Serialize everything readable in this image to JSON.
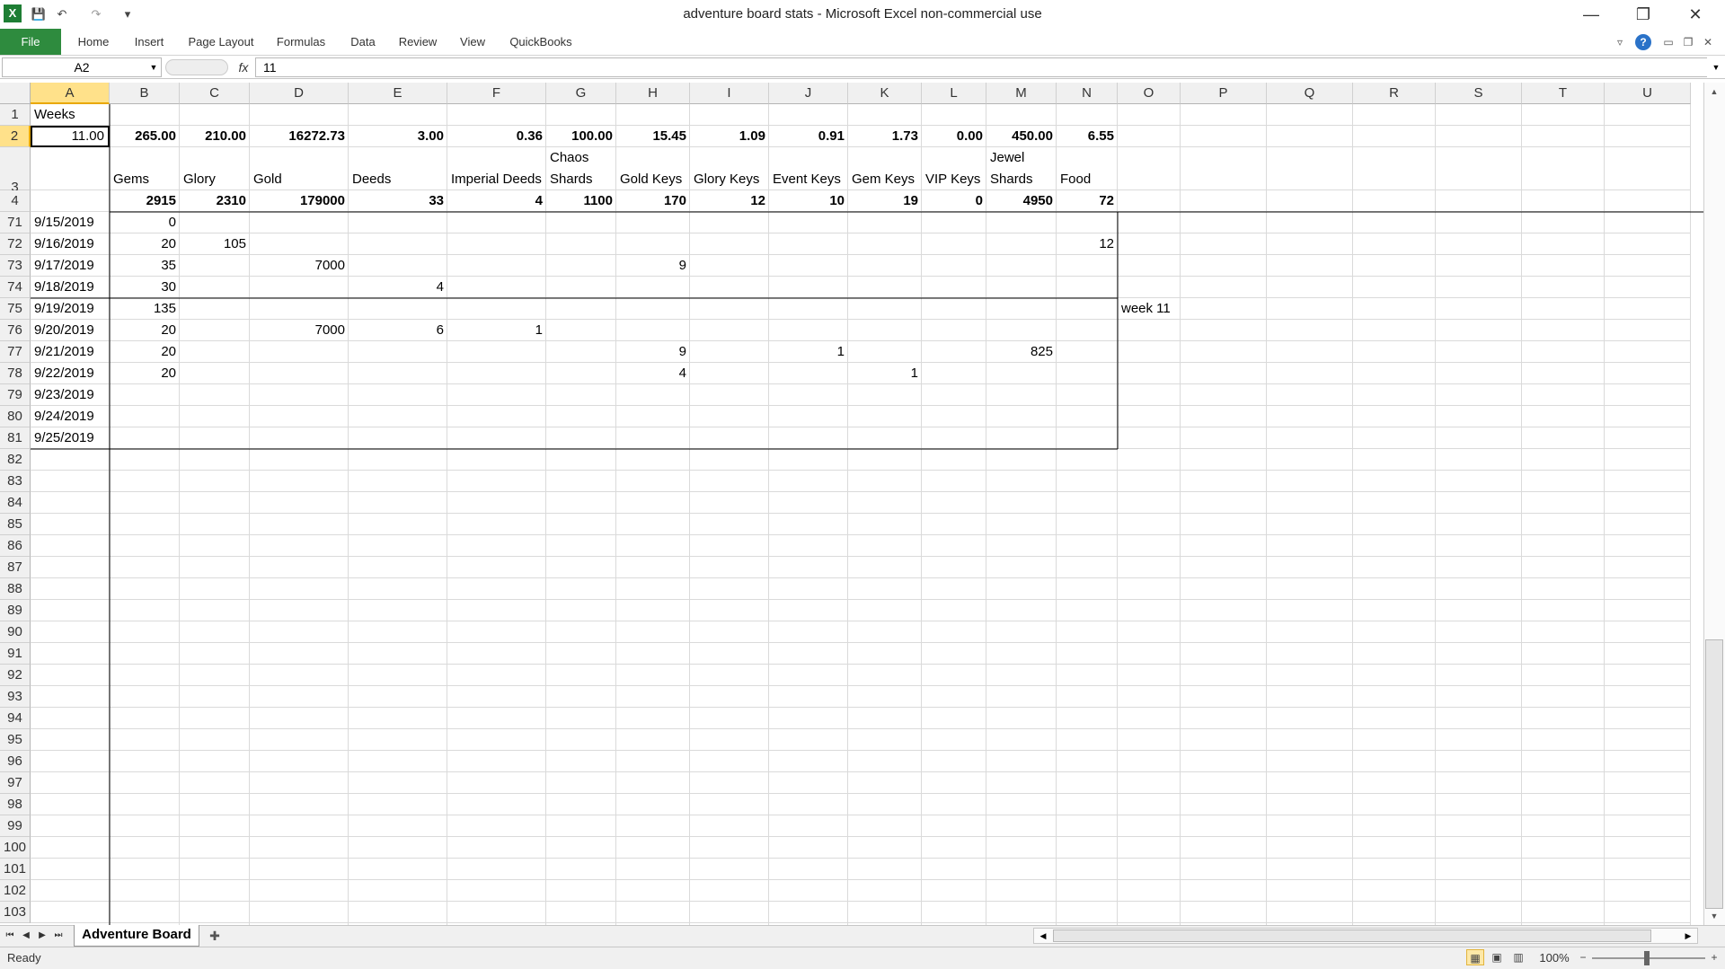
{
  "window": {
    "title": "adventure board stats  -  Microsoft Excel non-commercial use",
    "excel_icon": "X",
    "save_icon": "💾",
    "undo_icon": "↶",
    "redo_icon": "↷",
    "qat_menu": "▾",
    "minimize": "—",
    "restore": "❐",
    "close": "✕"
  },
  "ribbon": {
    "file": "File",
    "tabs": [
      "Home",
      "Insert",
      "Page Layout",
      "Formulas",
      "Data",
      "Review",
      "View",
      "QuickBooks"
    ],
    "help_icon": "?",
    "collapse_icon": "▿"
  },
  "formula_bar": {
    "name_box": "A2",
    "fx": "fx",
    "value": "11"
  },
  "columns": [
    "A",
    "B",
    "C",
    "D",
    "E",
    "F",
    "G",
    "H",
    "I",
    "J",
    "K",
    "L",
    "M",
    "N",
    "O",
    "P",
    "Q",
    "R",
    "S",
    "T",
    "U"
  ],
  "selected_column": "A",
  "selected_row": "2",
  "row_numbers": [
    "1",
    "2",
    "3",
    "71",
    "72",
    "73",
    "74",
    "75",
    "76",
    "77",
    "78",
    "79",
    "80",
    "81",
    "82",
    "83",
    "84",
    "85",
    "86",
    "87",
    "88",
    "89",
    "90",
    "91",
    "92",
    "93",
    "94",
    "95",
    "96",
    "97",
    "98",
    "99",
    "100",
    "101",
    "102",
    "103"
  ],
  "row_number_4": "4",
  "cells": {
    "A1": "Weeks",
    "A2": "11.00",
    "row2": [
      "265.00",
      "210.00",
      "16272.73",
      "3.00",
      "0.36",
      "100.00",
      "15.45",
      "1.09",
      "0.91",
      "1.73",
      "0.00",
      "450.00",
      "6.55"
    ],
    "headers": [
      "Gems",
      "Glory",
      "Gold",
      "Deeds",
      "Imperial Deeds",
      "Chaos Shards",
      "Gold Keys",
      "Glory Keys",
      "Event Keys",
      "Gem Keys",
      "VIP Keys",
      "Jewel Shards",
      "Food"
    ],
    "totals": [
      "2915",
      "2310",
      "179000",
      "33",
      "4",
      "1100",
      "170",
      "12",
      "10",
      "19",
      "0",
      "4950",
      "72"
    ],
    "dates": [
      "9/15/2019",
      "9/16/2019",
      "9/17/2019",
      "9/18/2019",
      "9/19/2019",
      "9/20/2019",
      "9/21/2019",
      "9/22/2019",
      "9/23/2019",
      "9/24/2019",
      "9/25/2019"
    ],
    "entries": {
      "r71_B": "0",
      "r72_B": "20",
      "r72_C": "105",
      "r72_N": "12",
      "r73_B": "35",
      "r73_D": "7000",
      "r73_H": "9",
      "r74_B": "30",
      "r74_E": "4",
      "r75_B": "135",
      "r75_O": "week 11",
      "r76_B": "20",
      "r76_D": "7000",
      "r76_E": "6",
      "r76_F": "1",
      "r77_B": "20",
      "r77_H": "9",
      "r77_J": "1",
      "r77_M": "825",
      "r78_B": "20",
      "r78_H": "4",
      "r78_K": "1"
    }
  },
  "sheet_tabs": {
    "active": "Adventure Board",
    "nav_first": "⏮",
    "nav_prev": "◀",
    "nav_next": "▶",
    "nav_last": "⏭",
    "new_sheet_icon": "✚"
  },
  "status": {
    "text": "Ready",
    "zoom": "100%",
    "zoom_out": "−",
    "zoom_in": "+",
    "view_normal": "▦",
    "view_layout": "▣",
    "view_break": "▥"
  }
}
